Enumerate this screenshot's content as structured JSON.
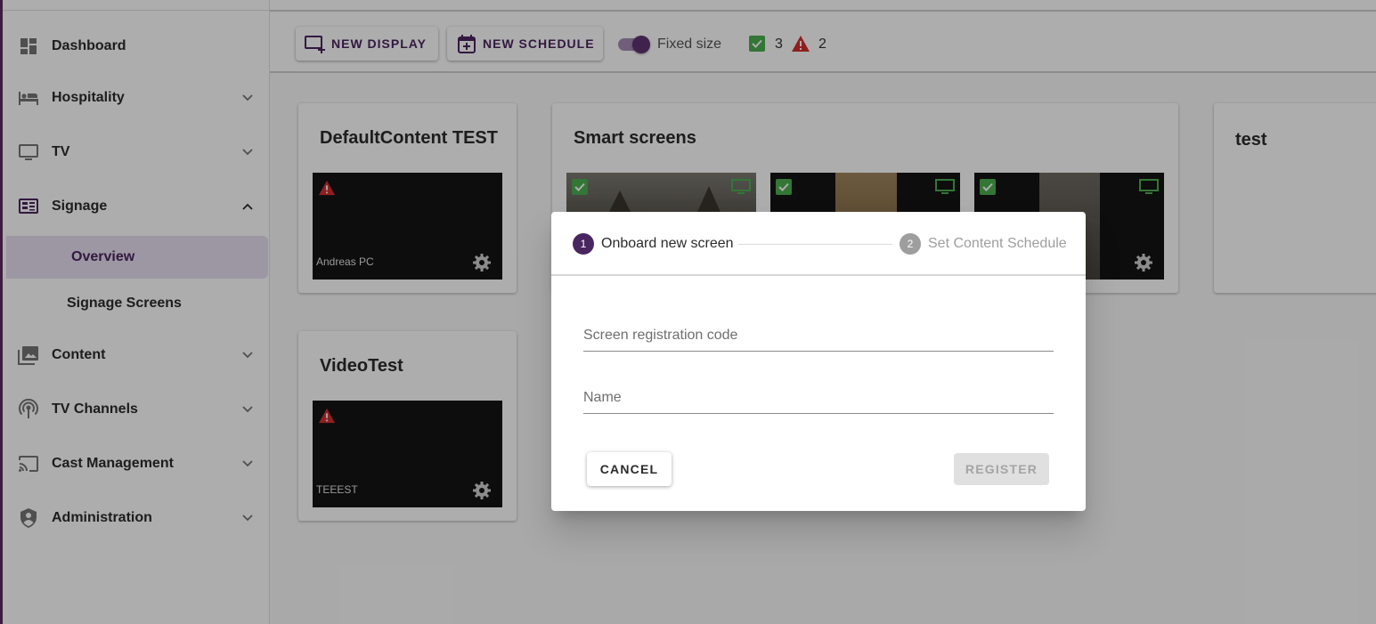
{
  "sidebar": {
    "items": [
      {
        "label": "Dashboard",
        "icon": "dashboard-icon"
      },
      {
        "label": "Hospitality",
        "icon": "bed-icon"
      },
      {
        "label": "TV",
        "icon": "tv-icon"
      },
      {
        "label": "Signage",
        "icon": "signage-icon"
      },
      {
        "label": "Content",
        "icon": "photo-library-icon"
      },
      {
        "label": "TV Channels",
        "icon": "broadcast-icon"
      },
      {
        "label": "Cast Management",
        "icon": "cast-icon"
      },
      {
        "label": "Administration",
        "icon": "shield-user-icon"
      }
    ],
    "signage_sub": [
      {
        "label": "Overview",
        "active": true
      },
      {
        "label": "Signage Screens",
        "active": false
      }
    ]
  },
  "toolbar": {
    "new_display_label": "NEW DISPLAY",
    "new_schedule_label": "NEW SCHEDULE",
    "fixed_size_label": "Fixed size",
    "fixed_size_on": true,
    "ok_count": "3",
    "warning_count": "2"
  },
  "groups": [
    {
      "title": "DefaultContent TEST",
      "screens": [
        {
          "name": "Andreas PC",
          "status": "warning"
        }
      ]
    },
    {
      "title": "Smart screens",
      "screens": [
        {
          "name": "",
          "status": "ok"
        },
        {
          "name": "",
          "status": "ok"
        },
        {
          "name": "",
          "status": "ok"
        }
      ]
    },
    {
      "title": "test",
      "screens": []
    },
    {
      "title": "VideoTest",
      "screens": [
        {
          "name": "TEEEST",
          "status": "warning"
        }
      ]
    }
  ],
  "dialog": {
    "step1_number": "1",
    "step1_label": "Onboard new screen",
    "step2_number": "2",
    "step2_label": "Set Content Schedule",
    "registration_placeholder": "Screen registration code",
    "registration_value": "",
    "name_placeholder": "Name",
    "name_value": "",
    "cancel_label": "CANCEL",
    "register_label": "REGISTER"
  },
  "colors": {
    "accent": "#4a2660",
    "ok_green": "#4caf50",
    "warning_red": "#d32f2f"
  }
}
